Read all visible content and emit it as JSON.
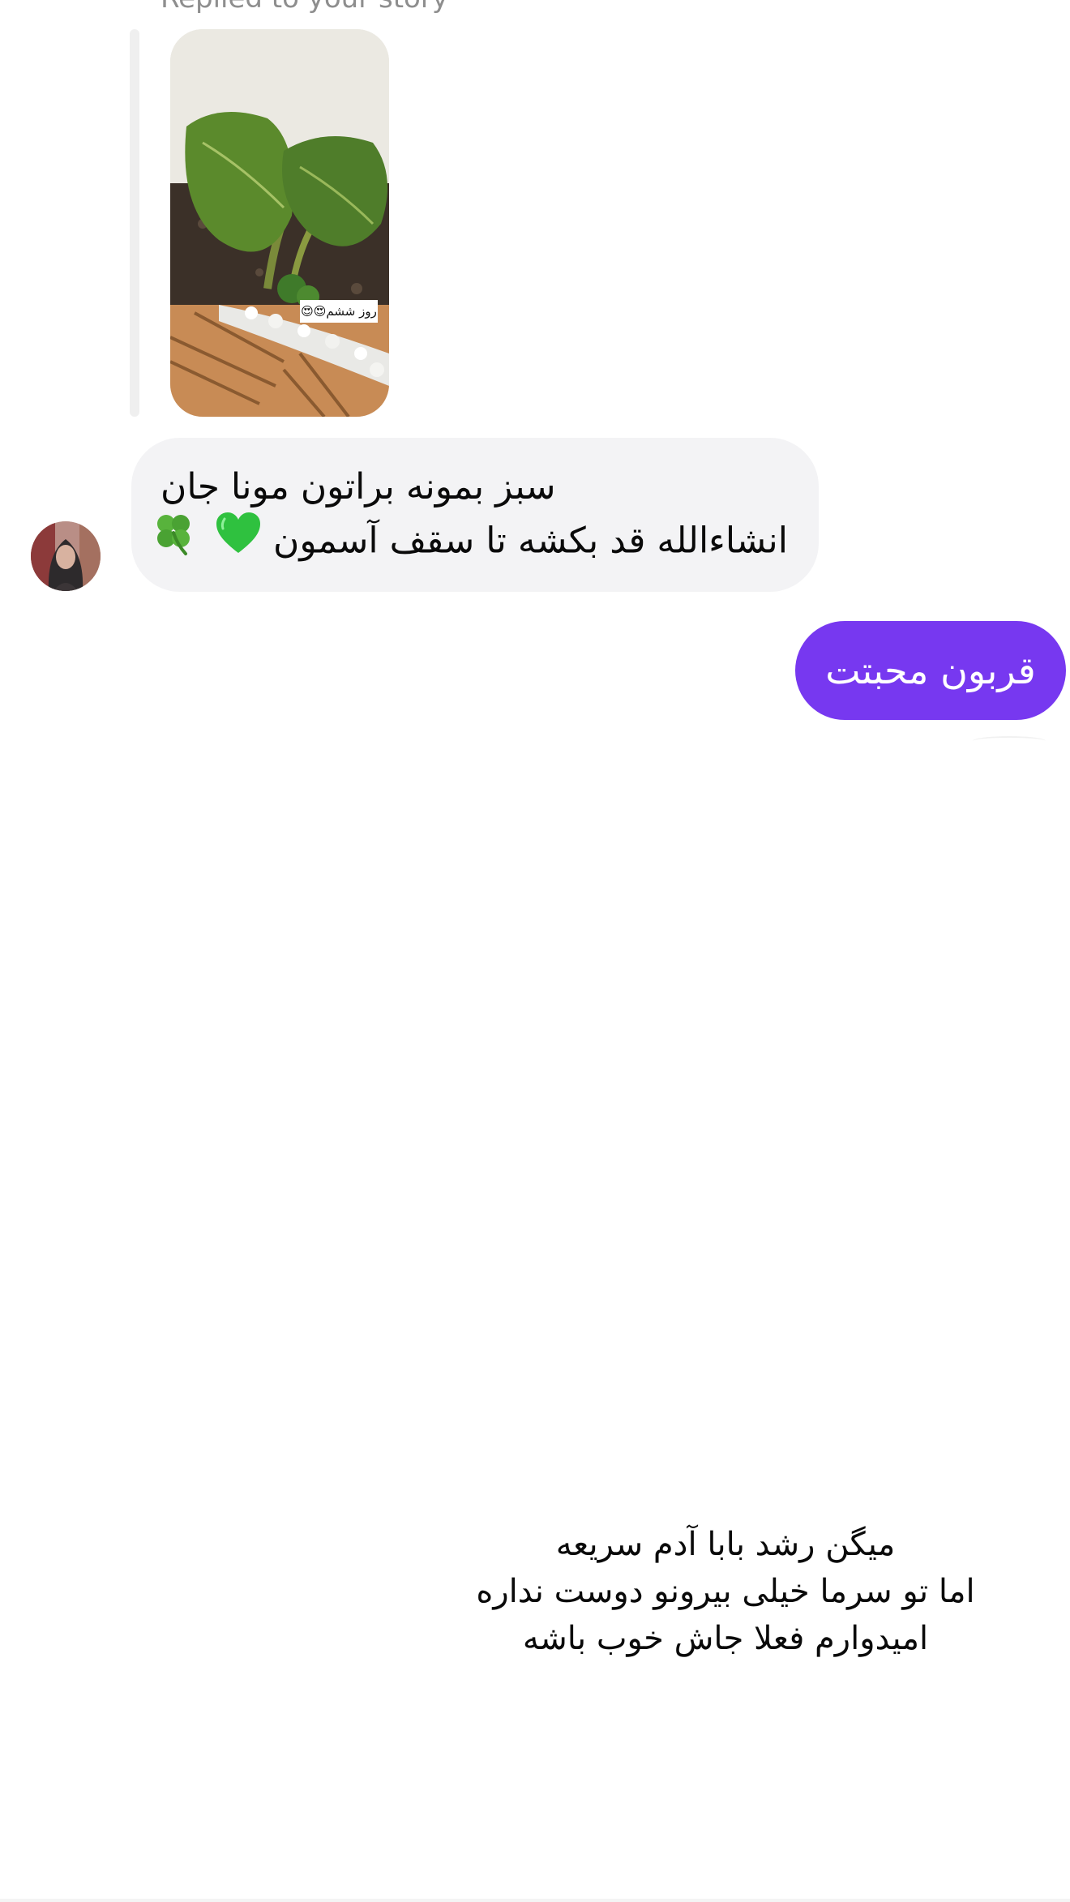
{
  "story_reply": {
    "label": "Replied to your story",
    "caption": "روز ششم😍😍"
  },
  "incoming_message": {
    "line1": "سبز بمونه براتون مونا جان",
    "line2": "انشاءالله قد بکشه تا سقف آسمون"
  },
  "outgoing_message": {
    "text": "قربون محبتت"
  },
  "note": {
    "line1": "میگن رشد بابا آدم سریعه",
    "line2": "اما تو سرما خیلی بیرونو دوست نداره",
    "line3": "امیدوارم فعلا جاش خوب باشه"
  },
  "colors": {
    "outgoing_bubble": "#7738f0",
    "incoming_bubble": "#f3f3f5",
    "secondary_text": "#8e8e8e"
  },
  "icons": {
    "heart": "green-heart-icon",
    "clover": "four-leaf-clover-icon"
  }
}
